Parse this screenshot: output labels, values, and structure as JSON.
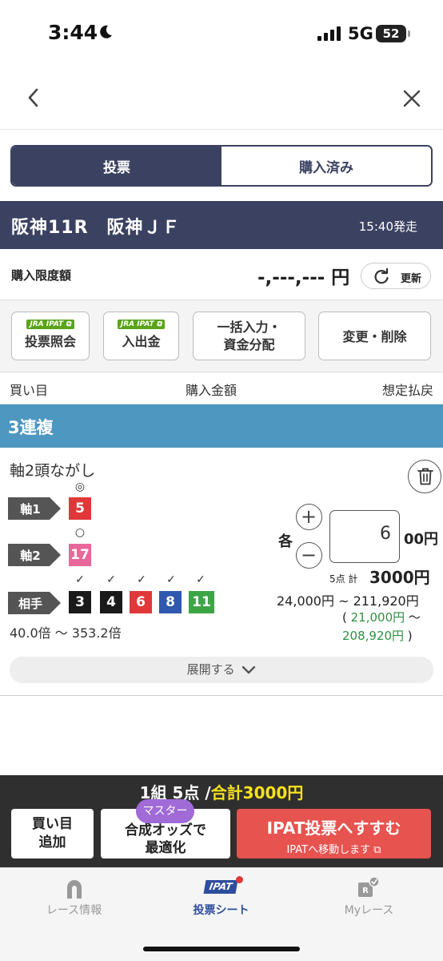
{
  "status_bar": {
    "time": "3:44",
    "network": "5G",
    "battery": "52"
  },
  "tabs": [
    {
      "label": "投票",
      "active": true
    },
    {
      "label": "購入済み",
      "active": false
    }
  ],
  "race": {
    "title": "阪神11R　阪神ＪＦ",
    "start_time": "15:40発走"
  },
  "limit": {
    "label": "購入限度額",
    "value": "-,---,--- 円",
    "refresh_label": "更新"
  },
  "actions": [
    {
      "badge": "JRA IPAT",
      "label": "投票照会"
    },
    {
      "badge": "JRA IPAT",
      "label": "入出金"
    },
    {
      "line1": "一括入力・",
      "line2": "資金分配"
    },
    {
      "label": "変更・削除"
    }
  ],
  "columns": {
    "col1": "買い目",
    "col2": "購入金額",
    "col3": "想定払戻"
  },
  "bet_type": "3連複",
  "bet": {
    "method": "軸2頭ながし",
    "axis1": {
      "label": "軸1",
      "mark": "◎",
      "horse": "5"
    },
    "axis2": {
      "label": "軸2",
      "mark": "○",
      "horse": "17"
    },
    "partners": {
      "label": "相手",
      "mark": "✓",
      "horses": [
        "3",
        "4",
        "6",
        "8",
        "11"
      ]
    },
    "odds_range": "40.0倍 〜 353.2倍",
    "each_label": "各",
    "amount_value": "6",
    "amount_unit": "00円",
    "points": "5点 計",
    "total": "3000円",
    "payout": "24,000円 ~ 211,920円",
    "payout_sub_open": "( ",
    "payout_sub_low": "21,000円",
    "payout_sub_tilde": " 〜",
    "payout_sub_high": "208,920円",
    "payout_sub_close": " )",
    "expand_label": "展開する"
  },
  "colors": {
    "navy": "#3b4261",
    "bet_type_blue": "#4d97c0",
    "horse_red": "#e0383a",
    "horse_pink": "#e8689a",
    "horse_black": "#1a1a1a",
    "horse_blue": "#2f59ae",
    "horse_green": "#3ea547"
  },
  "summary": {
    "prefix": "1組 5点 /",
    "total": "合計3000円",
    "add_line1": "買い目",
    "add_line2": "追加",
    "master_badge": "マスター",
    "optimize_line1": "合成オッズで",
    "optimize_line2": "最適化",
    "ipat_label": "IPAT投票へすすむ",
    "ipat_sub": "IPATへ移動します"
  },
  "bottom_nav": [
    {
      "label": "レース情報",
      "icon": "horseshoe-icon",
      "active": false
    },
    {
      "label": "投票シート",
      "icon": "ipat-icon",
      "badge_text": "IPAT",
      "active": true
    },
    {
      "label": "Myレース",
      "icon": "my-race-icon",
      "active": false
    }
  ]
}
